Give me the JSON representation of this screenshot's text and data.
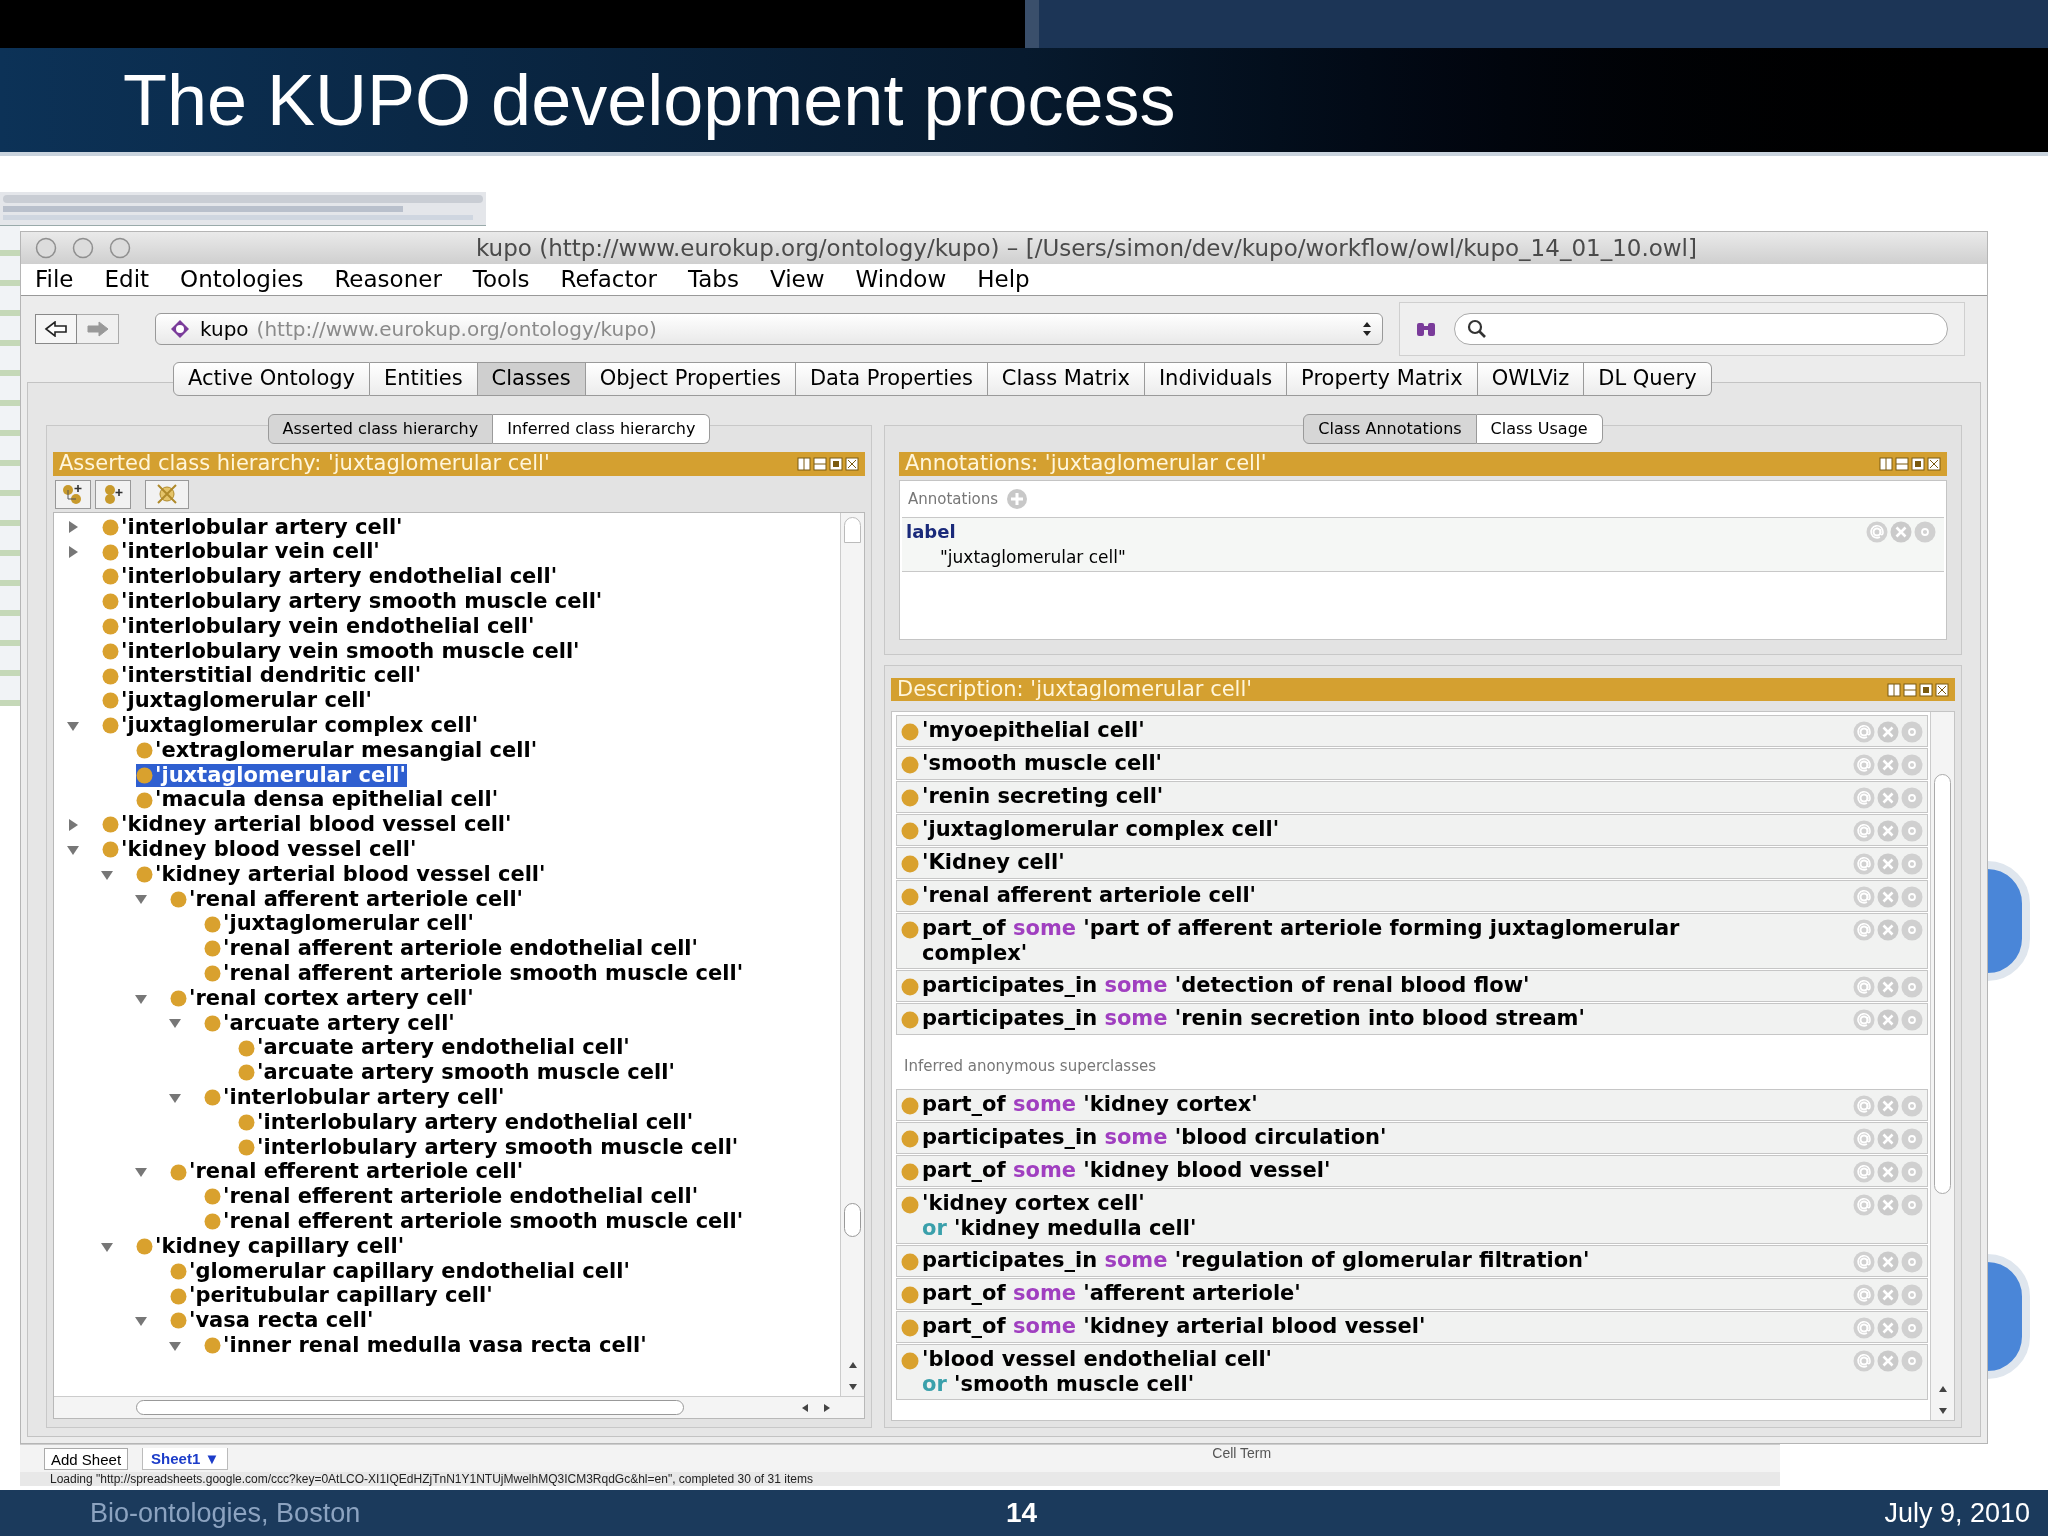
{
  "slide": {
    "title": "The KUPO development process",
    "footer_left": "Bio-ontologies, Boston",
    "page_number": "14",
    "date": "July 9, 2010"
  },
  "window": {
    "title": "kupo (http://www.eurokup.org/ontology/kupo) – [/Users/simon/dev/kupo/workflow/owl/kupo_14_01_10.owl]"
  },
  "menu": [
    "File",
    "Edit",
    "Ontologies",
    "Reasoner",
    "Tools",
    "Refactor",
    "Tabs",
    "View",
    "Window",
    "Help"
  ],
  "address": {
    "name": "kupo",
    "uri": "(http://www.eurokup.org/ontology/kupo)"
  },
  "tabs": [
    {
      "label": "Active Ontology",
      "selected": false
    },
    {
      "label": "Entities",
      "selected": false
    },
    {
      "label": "Classes",
      "selected": true
    },
    {
      "label": "Object Properties",
      "selected": false
    },
    {
      "label": "Data Properties",
      "selected": false
    },
    {
      "label": "Class Matrix",
      "selected": false
    },
    {
      "label": "Individuals",
      "selected": false
    },
    {
      "label": "Property Matrix",
      "selected": false
    },
    {
      "label": "OWLViz",
      "selected": false
    },
    {
      "label": "DL Query",
      "selected": false
    }
  ],
  "left_panel": {
    "view_tabs": [
      {
        "label": "Asserted class hierarchy",
        "selected": true
      },
      {
        "label": "Inferred class hierarchy",
        "selected": false
      }
    ],
    "header": "Asserted class hierarchy: 'juxtaglomerular cell'",
    "tree": [
      {
        "label": "'interlobular artery cell'",
        "selected": false,
        "expanded": false
      },
      {
        "label": "'interlobular vein cell'",
        "selected": false,
        "expanded": false
      },
      {
        "label": "'interlobulary artery endothelial cell'",
        "selected": false
      },
      {
        "label": "'interlobulary artery smooth muscle cell'",
        "selected": false
      },
      {
        "label": "'interlobulary vein endothelial cell'",
        "selected": false
      },
      {
        "label": "'interlobulary vein smooth muscle cell'",
        "selected": false
      },
      {
        "label": "'interstitial dendritic cell'",
        "selected": false
      },
      {
        "label": "'juxtaglomerular cell'",
        "selected": false
      },
      {
        "label": "'juxtaglomerular complex cell'",
        "selected": false,
        "expanded": true,
        "children": [
          {
            "label": "'extraglomerular mesangial cell'",
            "selected": false
          },
          {
            "label": "'juxtaglomerular cell'",
            "selected": true
          },
          {
            "label": "'macula densa epithelial cell'",
            "selected": false
          }
        ]
      },
      {
        "label": "'kidney arterial blood vessel cell'",
        "selected": false,
        "expanded": false
      },
      {
        "label": "'kidney blood vessel cell'",
        "selected": false,
        "expanded": true,
        "children": [
          {
            "label": "'kidney arterial blood vessel cell'",
            "selected": false,
            "expanded": true,
            "children": [
              {
                "label": "'renal afferent arteriole cell'",
                "selected": false,
                "expanded": true,
                "children": [
                  {
                    "label": "'juxtaglomerular cell'",
                    "selected": false
                  },
                  {
                    "label": "'renal afferent arteriole endothelial cell'",
                    "selected": false
                  },
                  {
                    "label": "'renal afferent arteriole smooth muscle cell'",
                    "selected": false
                  }
                ]
              },
              {
                "label": "'renal cortex artery cell'",
                "selected": false,
                "expanded": true,
                "children": [
                  {
                    "label": "'arcuate artery cell'",
                    "selected": false,
                    "expanded": true,
                    "children": [
                      {
                        "label": "'arcuate artery endothelial cell'",
                        "selected": false
                      },
                      {
                        "label": "'arcuate artery smooth muscle cell'",
                        "selected": false
                      }
                    ]
                  },
                  {
                    "label": "'interlobular artery cell'",
                    "selected": false,
                    "expanded": true,
                    "children": [
                      {
                        "label": "'interlobulary artery endothelial cell'",
                        "selected": false
                      },
                      {
                        "label": "'interlobulary artery smooth muscle cell'",
                        "selected": false
                      }
                    ]
                  }
                ]
              },
              {
                "label": "'renal efferent arteriole cell'",
                "selected": false,
                "expanded": true,
                "children": [
                  {
                    "label": "'renal efferent arteriole endothelial cell'",
                    "selected": false
                  },
                  {
                    "label": "'renal efferent arteriole smooth muscle cell'",
                    "selected": false
                  }
                ]
              }
            ]
          },
          {
            "label": "'kidney capillary cell'",
            "selected": false,
            "expanded": true,
            "children": [
              {
                "label": "'glomerular capillary endothelial cell'",
                "selected": false
              },
              {
                "label": "'peritubular capillary cell'",
                "selected": false
              },
              {
                "label": "'vasa recta cell'",
                "selected": false,
                "expanded": true,
                "children": [
                  {
                    "label": "'inner renal medulla vasa recta cell'",
                    "selected": false,
                    "expanded": true
                  }
                ]
              }
            ]
          }
        ]
      }
    ]
  },
  "right_panel": {
    "view_tabs": [
      {
        "label": "Class Annotations",
        "selected": true
      },
      {
        "label": "Class Usage",
        "selected": false
      }
    ],
    "annotations": {
      "header": "Annotations: 'juxtaglomerular cell'",
      "section_label": "Annotations",
      "items": [
        {
          "property": "label",
          "value": "\"juxtaglomerular cell\""
        }
      ]
    },
    "description": {
      "header": "Description: 'juxtaglomerular cell'",
      "rows": [
        {
          "lines": [
            [
              {
                "text": "'myoepithelial cell'",
                "kind": "class"
              }
            ]
          ]
        },
        {
          "lines": [
            [
              {
                "text": "'smooth muscle cell'",
                "kind": "class"
              }
            ]
          ]
        },
        {
          "lines": [
            [
              {
                "text": "'renin secreting cell'",
                "kind": "class"
              }
            ]
          ]
        },
        {
          "lines": [
            [
              {
                "text": "'juxtaglomerular complex cell'",
                "kind": "class"
              }
            ]
          ]
        },
        {
          "lines": [
            [
              {
                "text": "'Kidney cell'",
                "kind": "class"
              }
            ]
          ]
        },
        {
          "lines": [
            [
              {
                "text": "'renal afferent arteriole cell'",
                "kind": "class"
              }
            ]
          ]
        },
        {
          "lines": [
            [
              {
                "text": "part_of",
                "kind": "class"
              },
              {
                "text": "some",
                "kind": "some"
              },
              {
                "text": "'part of afferent arteriole forming juxtaglomerular complex'",
                "kind": "class"
              }
            ]
          ]
        },
        {
          "lines": [
            [
              {
                "text": "participates_in",
                "kind": "class"
              },
              {
                "text": "some",
                "kind": "some"
              },
              {
                "text": "'detection of renal blood flow'",
                "kind": "class"
              }
            ]
          ]
        },
        {
          "lines": [
            [
              {
                "text": "participates_in",
                "kind": "class"
              },
              {
                "text": "some",
                "kind": "some"
              },
              {
                "text": "'renin secretion into blood stream'",
                "kind": "class"
              }
            ]
          ]
        }
      ],
      "inferred_label": "Inferred anonymous superclasses",
      "inferred_rows": [
        {
          "lines": [
            [
              {
                "text": "part_of",
                "kind": "class"
              },
              {
                "text": "some",
                "kind": "some"
              },
              {
                "text": "'kidney cortex'",
                "kind": "class"
              }
            ]
          ]
        },
        {
          "lines": [
            [
              {
                "text": "participates_in",
                "kind": "class"
              },
              {
                "text": "some",
                "kind": "some"
              },
              {
                "text": "'blood circulation'",
                "kind": "class"
              }
            ]
          ]
        },
        {
          "lines": [
            [
              {
                "text": "part_of",
                "kind": "class"
              },
              {
                "text": "some",
                "kind": "some"
              },
              {
                "text": "'kidney blood vessel'",
                "kind": "class"
              }
            ]
          ]
        },
        {
          "lines": [
            [
              {
                "text": "'kidney cortex cell'",
                "kind": "class"
              }
            ],
            [
              {
                "text": "or",
                "kind": "or"
              },
              {
                "text": "'kidney medulla cell'",
                "kind": "class"
              }
            ]
          ]
        },
        {
          "lines": [
            [
              {
                "text": "participates_in",
                "kind": "class"
              },
              {
                "text": "some",
                "kind": "some"
              },
              {
                "text": "'regulation of glomerular filtration'",
                "kind": "class"
              }
            ]
          ]
        },
        {
          "lines": [
            [
              {
                "text": "part_of",
                "kind": "class"
              },
              {
                "text": "some",
                "kind": "some"
              },
              {
                "text": "'afferent arteriole'",
                "kind": "class"
              }
            ]
          ]
        },
        {
          "lines": [
            [
              {
                "text": "part_of",
                "kind": "class"
              },
              {
                "text": "some",
                "kind": "some"
              },
              {
                "text": "'kidney arterial blood vessel'",
                "kind": "class"
              }
            ]
          ]
        },
        {
          "lines": [
            [
              {
                "text": "'blood vessel endothelial cell'",
                "kind": "class"
              }
            ],
            [
              {
                "text": "or",
                "kind": "or"
              },
              {
                "text": "'smooth muscle cell'",
                "kind": "class"
              }
            ]
          ]
        }
      ]
    }
  },
  "spreadsheet": {
    "add_sheet": "Add Sheet",
    "sheet_tab": "Sheet1 ▼",
    "cell_term": "Cell Term",
    "status": "Loading \"http://spreadsheets.google.com/ccc?key=0AtLCO-XI1IQEdHZjTnN1Y1NTUjMwelhMQ3ICM3RqdGc&hl=en\", completed 30 of 31 items"
  }
}
